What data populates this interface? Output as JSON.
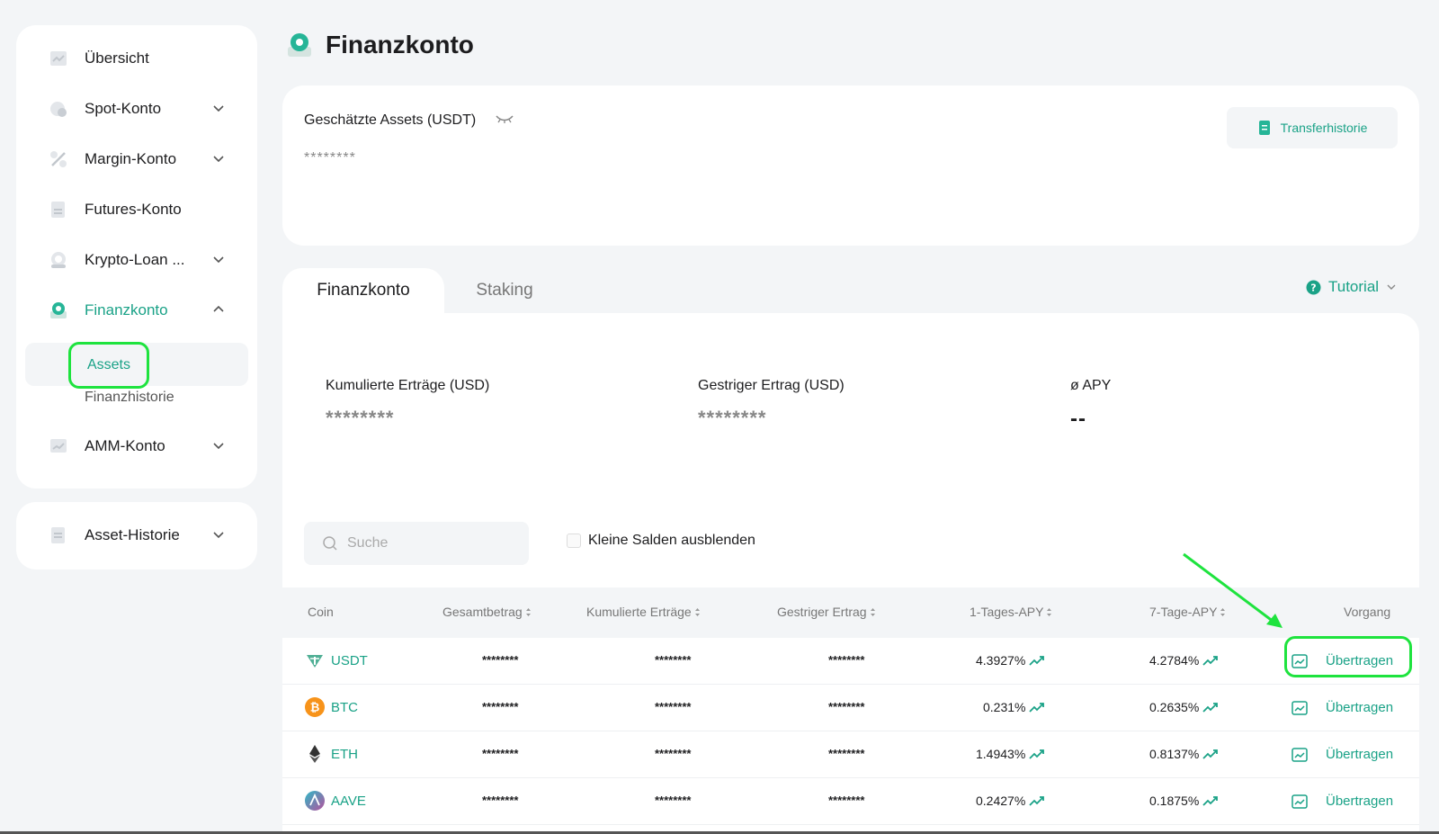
{
  "sidebar": {
    "items": [
      {
        "label": "Übersicht",
        "icon": "overview-icon",
        "chevron": false
      },
      {
        "label": "Spot-Konto",
        "icon": "spot-icon",
        "chevron": true
      },
      {
        "label": "Margin-Konto",
        "icon": "percent-icon",
        "chevron": true
      },
      {
        "label": "Futures-Konto",
        "icon": "futures-icon",
        "chevron": false
      },
      {
        "label": "Krypto-Loan ...",
        "icon": "loan-icon",
        "chevron": true
      },
      {
        "label": "Finanzkonto",
        "icon": "finance-icon",
        "chevron": true,
        "expanded": true
      },
      {
        "label": "AMM-Konto",
        "icon": "amm-icon",
        "chevron": true
      }
    ],
    "sub_items": [
      "Assets",
      "Finanzhistorie"
    ],
    "history": {
      "label": "Asset-Historie"
    }
  },
  "header": {
    "title": "Finanzkonto"
  },
  "assets": {
    "label": "Geschätzte Assets (USDT)",
    "value": "********",
    "transfer_history": "Transferhistorie"
  },
  "tabs": [
    "Finanzkonto",
    "Staking"
  ],
  "tutorial": "Tutorial",
  "stats": [
    {
      "label": "Kumulierte Erträge (USD)",
      "value": "********"
    },
    {
      "label": "Gestriger Ertrag (USD)",
      "value": "********"
    },
    {
      "label": "ø APY",
      "value": "--"
    }
  ],
  "search": {
    "placeholder": "Suche"
  },
  "hide_small": "Kleine Salden ausblenden",
  "table": {
    "headers": [
      "Coin",
      "Gesamtbetrag",
      "Kumulierte Erträge",
      "Gestriger Ertrag",
      "1-Tages-APY",
      "7-Tage-APY",
      "Vorgang"
    ],
    "rows": [
      {
        "coin": "USDT",
        "total": "********",
        "cum": "********",
        "yest": "********",
        "apy1": "4.3927%",
        "apy7": "4.2784%",
        "action": "Übertragen"
      },
      {
        "coin": "BTC",
        "total": "********",
        "cum": "********",
        "yest": "********",
        "apy1": "0.231%",
        "apy7": "0.2635%",
        "action": "Übertragen"
      },
      {
        "coin": "ETH",
        "total": "********",
        "cum": "********",
        "yest": "********",
        "apy1": "1.4943%",
        "apy7": "0.8137%",
        "action": "Übertragen"
      },
      {
        "coin": "AAVE",
        "total": "********",
        "cum": "********",
        "yest": "********",
        "apy1": "0.2427%",
        "apy7": "0.1875%",
        "action": "Übertragen"
      }
    ]
  },
  "colors": {
    "accent": "#1aa287",
    "highlight": "#1ee33e",
    "bg": "#f3f5f7"
  }
}
